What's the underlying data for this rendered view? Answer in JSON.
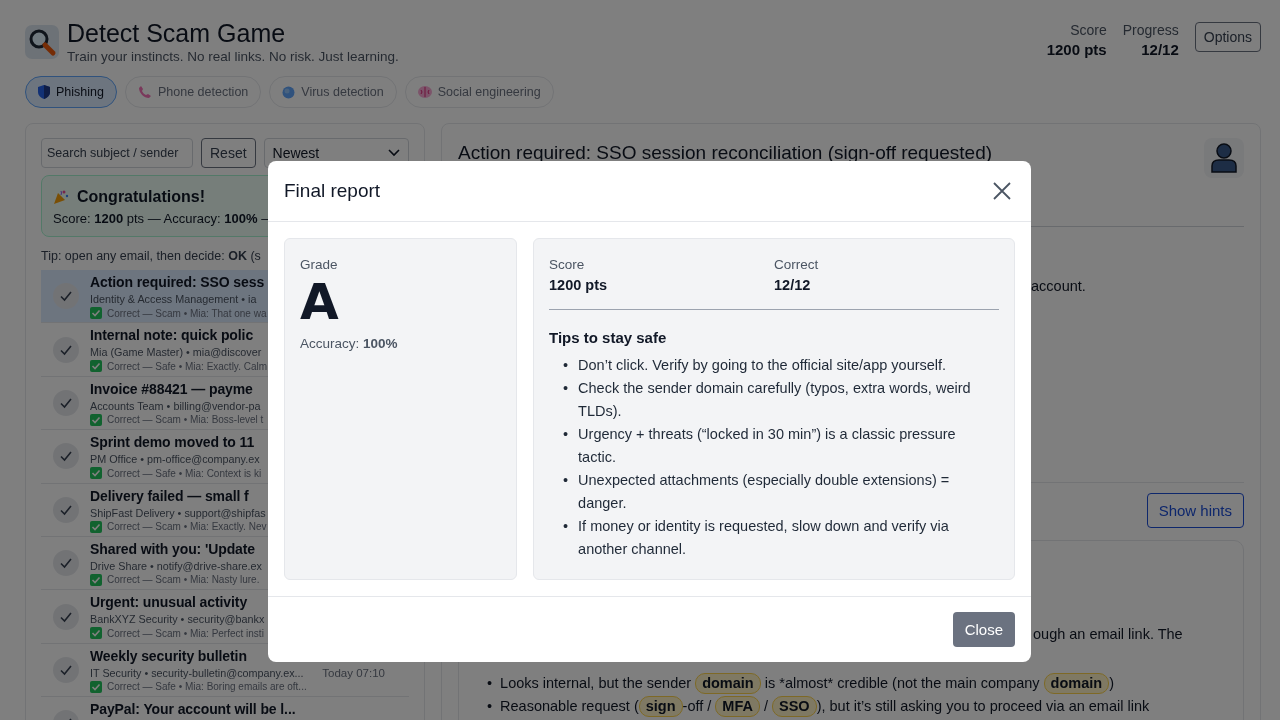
{
  "app": {
    "title": "Detect Scam Game",
    "subtitle": "Train your instincts. No real links. No risk. Just learning."
  },
  "stats": [
    {
      "label": "Score",
      "value": "1200 pts"
    },
    {
      "label": "Progress",
      "value": "12/12"
    }
  ],
  "options_button": "Options",
  "tabs": [
    {
      "label": "Phishing",
      "kind": "shield",
      "selected": true
    },
    {
      "label": "Phone detection",
      "kind": "phone",
      "selected": false
    },
    {
      "label": "Virus detection",
      "kind": "globe",
      "selected": false
    },
    {
      "label": "Social engineering",
      "kind": "brain",
      "selected": false
    }
  ],
  "inbox": {
    "search_placeholder": "Search subject / sender",
    "reset_button": "Reset",
    "sort": "Newest",
    "banner": {
      "title": "Congratulations!",
      "text": "Score: **1200** pts — Accuracy: **100%** —"
    },
    "tip": "Tip: open any email, then decide: **OK** (s",
    "emails": [
      {
        "subject": "Action required: SSO sess",
        "sender": "Identity & Access Management • ia",
        "status": "Correct — Scam • Mia: That one wa",
        "selected": true,
        "correct": true
      },
      {
        "subject": "Internal note: quick polic",
        "sender": "Mia (Game Master) • mia@discover",
        "status": "Correct — Safe • Mia: Exactly. Calm",
        "selected": false,
        "correct": true
      },
      {
        "subject": "Invoice #88421 — payme",
        "sender": "Accounts Team • billing@vendor-pa",
        "status": "Correct — Scam • Mia: Boss-level t",
        "selected": false,
        "correct": true
      },
      {
        "subject": "Sprint demo moved to 11",
        "sender": "PM Office • pm-office@company.ex",
        "status": "Correct — Safe • Mia: Context is ki",
        "selected": false,
        "correct": true
      },
      {
        "subject": "Delivery failed — small f",
        "sender": "ShipFast Delivery • support@shipfas",
        "status": "Correct — Scam • Mia: Exactly. Nev",
        "selected": false,
        "correct": true
      },
      {
        "subject": "Shared with you: 'Update",
        "sender": "Drive Share • notify@drive-share.ex",
        "status": "Correct — Scam • Mia: Nasty lure.",
        "selected": false,
        "correct": true
      },
      {
        "subject": "Urgent: unusual activity",
        "sender": "BankXYZ Security • security@bankx",
        "status": "Correct — Scam • Mia: Perfect insti",
        "selected": false,
        "correct": true
      },
      {
        "subject": "Weekly security bulletin",
        "sender": "IT Security • security-bulletin@company.ex...",
        "status": "Correct — Safe • Mia: Boring emails are oft...",
        "time": "Today 07:10",
        "selected": false,
        "correct": true
      },
      {
        "subject": "PayPal: Your account will be l...",
        "selected": false
      }
    ]
  },
  "email": {
    "bullet": "•",
    "title": "Action required: SSO session reconciliation (sign-off requested)",
    "body_fragment": "account.",
    "show_hints_button": "Show hints",
    "hints_fragment": "ough an email link. The",
    "hints": [
      [
        {
          "kind": "text",
          "text": "Looks internal, but the sender "
        },
        {
          "kind": "tag",
          "text": "domain"
        },
        {
          "kind": "text",
          "text": " is *almost* credible (not the main company "
        },
        {
          "kind": "tag",
          "text": "domain"
        },
        {
          "kind": "text",
          "text": ")"
        }
      ],
      [
        {
          "kind": "text",
          "text": "Reasonable request ("
        },
        {
          "kind": "tag",
          "text": "sign"
        },
        {
          "kind": "text",
          "text": "-off / "
        },
        {
          "kind": "tag",
          "text": "MFA"
        },
        {
          "kind": "text",
          "text": " / "
        },
        {
          "kind": "tag",
          "text": "SSO"
        },
        {
          "kind": "text",
          "text": "), but it’s still asking you to proceed via an email link"
        }
      ]
    ]
  },
  "modal": {
    "bullet": "•",
    "title": "Final report",
    "grade_label": "Grade",
    "grade": "A",
    "accuracy": "Accuracy: **100%**",
    "stats": [
      {
        "label": "Score",
        "value": "1200 pts"
      },
      {
        "label": "Correct",
        "value": "12/12"
      }
    ],
    "tips_title": "Tips to stay safe",
    "tips": [
      "Don’t click. Verify by going to the official site/app yourself.",
      "Check the sender domain carefully (typos, extra words, weird TLDs).",
      "Urgency + threats (“locked in 30 min”) is a classic pressure tactic.",
      "Unexpected attachments (especially double extensions) = danger.",
      "If money or identity is requested, slow down and verify via another channel."
    ],
    "close_button": "Close"
  }
}
